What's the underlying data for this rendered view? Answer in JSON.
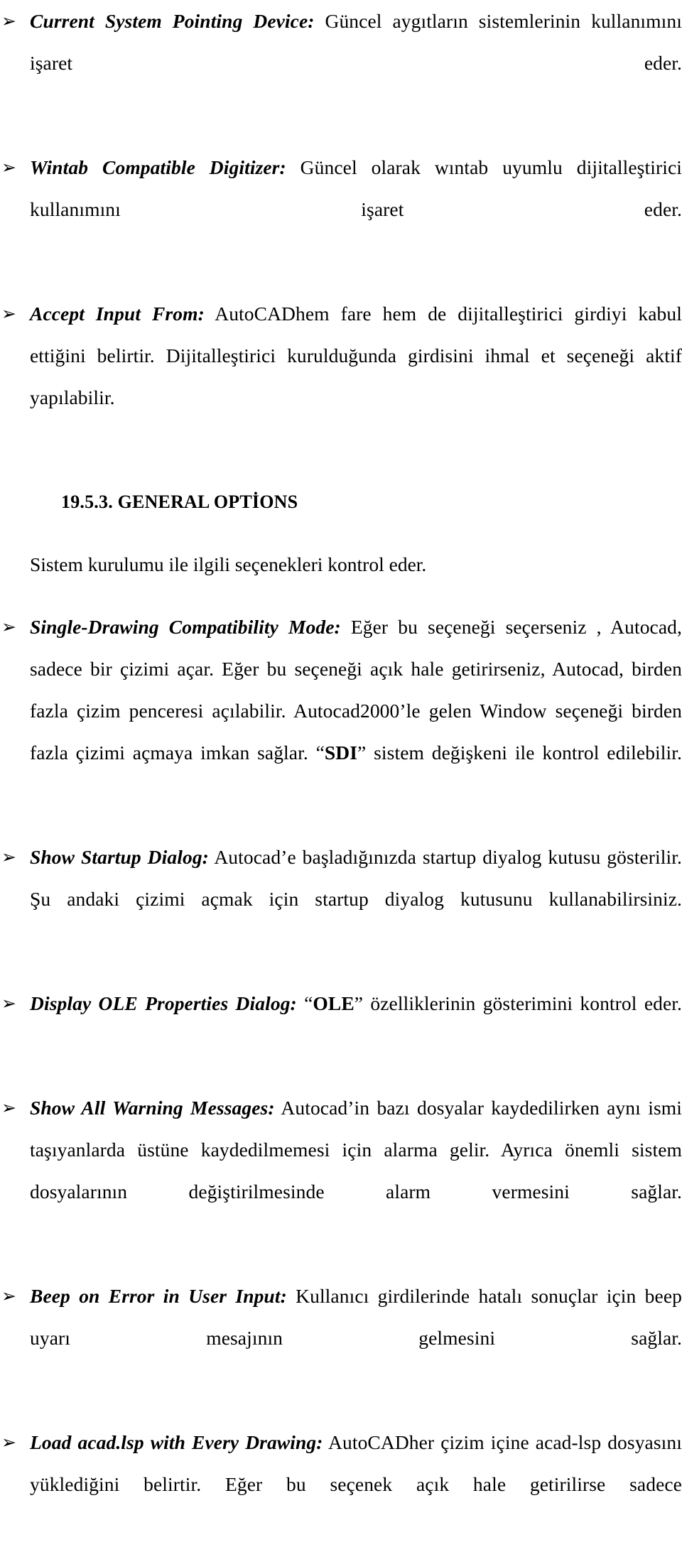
{
  "document": {
    "language": "Turkish",
    "bullet_glyph": "➢",
    "blocks": [
      {
        "kind": "bullet",
        "term": "Current System Pointing Device:",
        "text": " Güncel aygıtların sistemlerinin kullanımını işaret eder."
      },
      {
        "kind": "bullet",
        "term": "Wintab Compatible Digitizer:",
        "text": " Güncel olarak wıntab uyumlu dijitalleştirici kullanımını işaret eder."
      },
      {
        "kind": "bullet",
        "term": "Accept Input From:",
        "text": " AutoCADhem fare hem de dijitalleştirici girdiyi  kabul ettiğini  belirtir. Dijitalleştirici kurulduğunda girdisini  ihmal et seçeneği aktif yapılabilir."
      },
      {
        "kind": "heading",
        "text": "19.5.3. GENERAL OPTİONS"
      },
      {
        "kind": "paragraph",
        "text": "Sistem kurulumu ile ilgili seçenekleri kontrol eder."
      },
      {
        "kind": "bullet",
        "term": "Single-Drawing Compatibility Mode:",
        "text": " Eğer bu seçeneği  seçerseniz , Autocad, sadece bir çizimi  açar. Eğer bu seçeneği  açık hale getirirseniz, Autocad, birden fazla çizim penceresi açılabilir. Autocad2000’le gelen Window seçeneği birden fazla çizimi açmaya imkan sağlar. “",
        "emphasis": "SDI",
        "text_after": "” sistem değişkeni ile kontrol edilebilir."
      },
      {
        "kind": "bullet",
        "term": "Show Startup Dialog:",
        "text": " Autocad’e   başladığınızda startup diyalog kutusu gösterilir. Şu andaki çizimi açmak için startup diyalog kutusunu kullanabilirsiniz."
      },
      {
        "kind": "bullet",
        "term": "Display OLE Properties Dialog:",
        "text": " “",
        "emphasis": "OLE",
        "text_after": "” özelliklerinin gösterimini  kontrol eder."
      },
      {
        "kind": "bullet",
        "term": "Show All Warning Messages:",
        "text": " Autocad’in bazı dosyalar kaydedilirken aynı ismi taşıyanlarda üstüne kaydedilmemesi için alarma gelir. Ayrıca önemli sistem dosyalarının değiştirilmesinde alarm vermesini sağlar."
      },
      {
        "kind": "bullet",
        "term": "Beep on Error in User Input:",
        "text": " Kullanıcı girdilerinde hatalı sonuçlar için beep uyarı mesajının gelmesini sağlar."
      },
      {
        "kind": "bullet",
        "term": "Load acad.lsp with Every Drawing:",
        "text": " AutoCADher çizim içine acad-lsp dosyasını  yüklediğini  belirtir. Eğer bu seçenek açık hale getirilirse sadece"
      }
    ]
  }
}
